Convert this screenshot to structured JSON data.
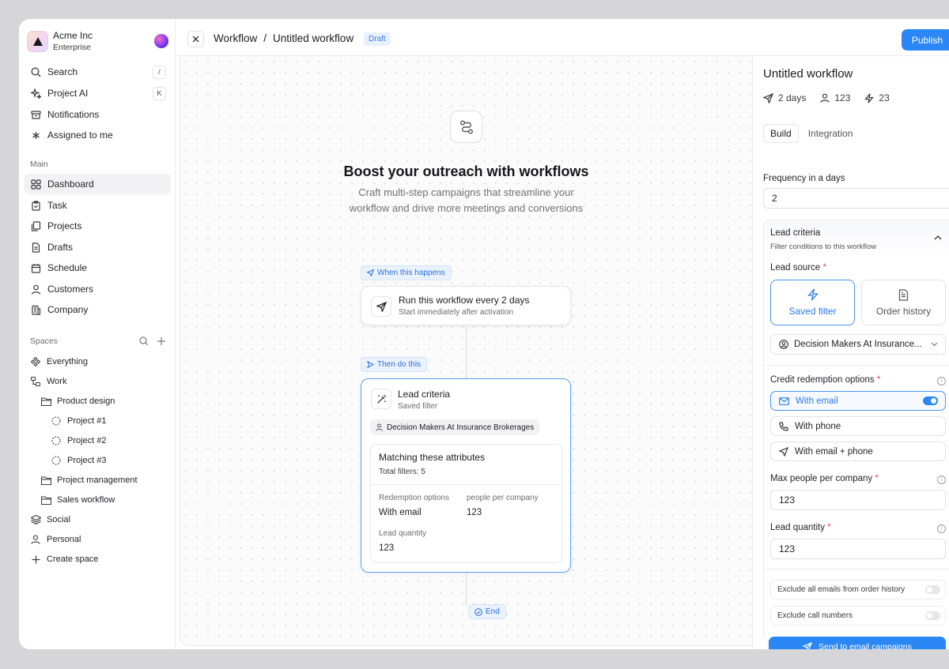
{
  "org": {
    "name": "Acme Inc",
    "plan": "Enterprise"
  },
  "nav": {
    "search": {
      "label": "Search",
      "shortcut": "/"
    },
    "project_ai": {
      "label": "Project AI",
      "shortcut": "K"
    },
    "notifications": "Notifications",
    "assigned": "Assigned to me"
  },
  "main_section": {
    "label": "Main",
    "items": [
      "Dashboard",
      "Task",
      "Projects",
      "Drafts",
      "Schedule",
      "Customers",
      "Company"
    ]
  },
  "spaces": {
    "label": "Spaces",
    "everything": "Everything",
    "work": "Work",
    "product_design": "Product design",
    "projects": [
      "Project #1",
      "Project #2",
      "Project #3"
    ],
    "project_management": "Project management",
    "sales_workflow": "Sales workflow",
    "social": "Social",
    "personal": "Personal",
    "create": "Create space"
  },
  "topbar": {
    "crumb_root": "Workflow",
    "separator": "/",
    "crumb_current": "Untitled workflow",
    "status": "Draft",
    "publish": "Publish"
  },
  "canvas": {
    "title": "Boost your outreach with workflows",
    "subtitle": "Craft multi-step campaigns that streamline your workflow and drive more meetings and conversions",
    "trigger_chip": "When this happens",
    "trigger_title": "Run this workflow every 2 days",
    "trigger_sub": "Start immediately after activation",
    "action_chip": "Then do this",
    "action_title": "Lead criteria",
    "action_sub": "Saved filter",
    "segment": "Decision Makers At Insurance Brokerages",
    "attributes_title": "Matching these attributes",
    "attributes_sub": "Total filters: 5",
    "redemption_label": "Redemption options",
    "redemption_value": "With email",
    "people_label": "people per company",
    "people_value": "123",
    "quantity_label": "Lead quantity",
    "quantity_value": "123",
    "end": "End"
  },
  "panel": {
    "title": "Untitled workflow",
    "stat_days": "2 days",
    "stat_people": "123",
    "stat_actions": "23",
    "tabs": [
      "Build",
      "Integration"
    ],
    "frequency_label": "Frequency in a days",
    "frequency_value": "2",
    "criteria_title": "Lead criteria",
    "criteria_sub": "Filter conditions to this workflow",
    "lead_source_label": "Lead source",
    "source_saved": "Saved filter",
    "source_order": "Order history",
    "segment_select": "Decision Makers At Insurance...",
    "credit_label": "Credit redemption options",
    "opt_email": "With email",
    "opt_phone": "With phone",
    "opt_email_phone": "With email + phone",
    "max_people_label": "Max people per company",
    "max_people_value": "123",
    "lead_qty_label": "Lead quantity",
    "lead_qty_value": "123",
    "exclude_emails": "Exclude all emails from order history",
    "exclude_calls": "Exclude call numbers",
    "send_button": "Send to email campaigns",
    "required_mark": "*"
  },
  "colors": {
    "accent": "#2b87f5",
    "draft_bg": "#e8f1ff",
    "required": "#e5484d"
  }
}
